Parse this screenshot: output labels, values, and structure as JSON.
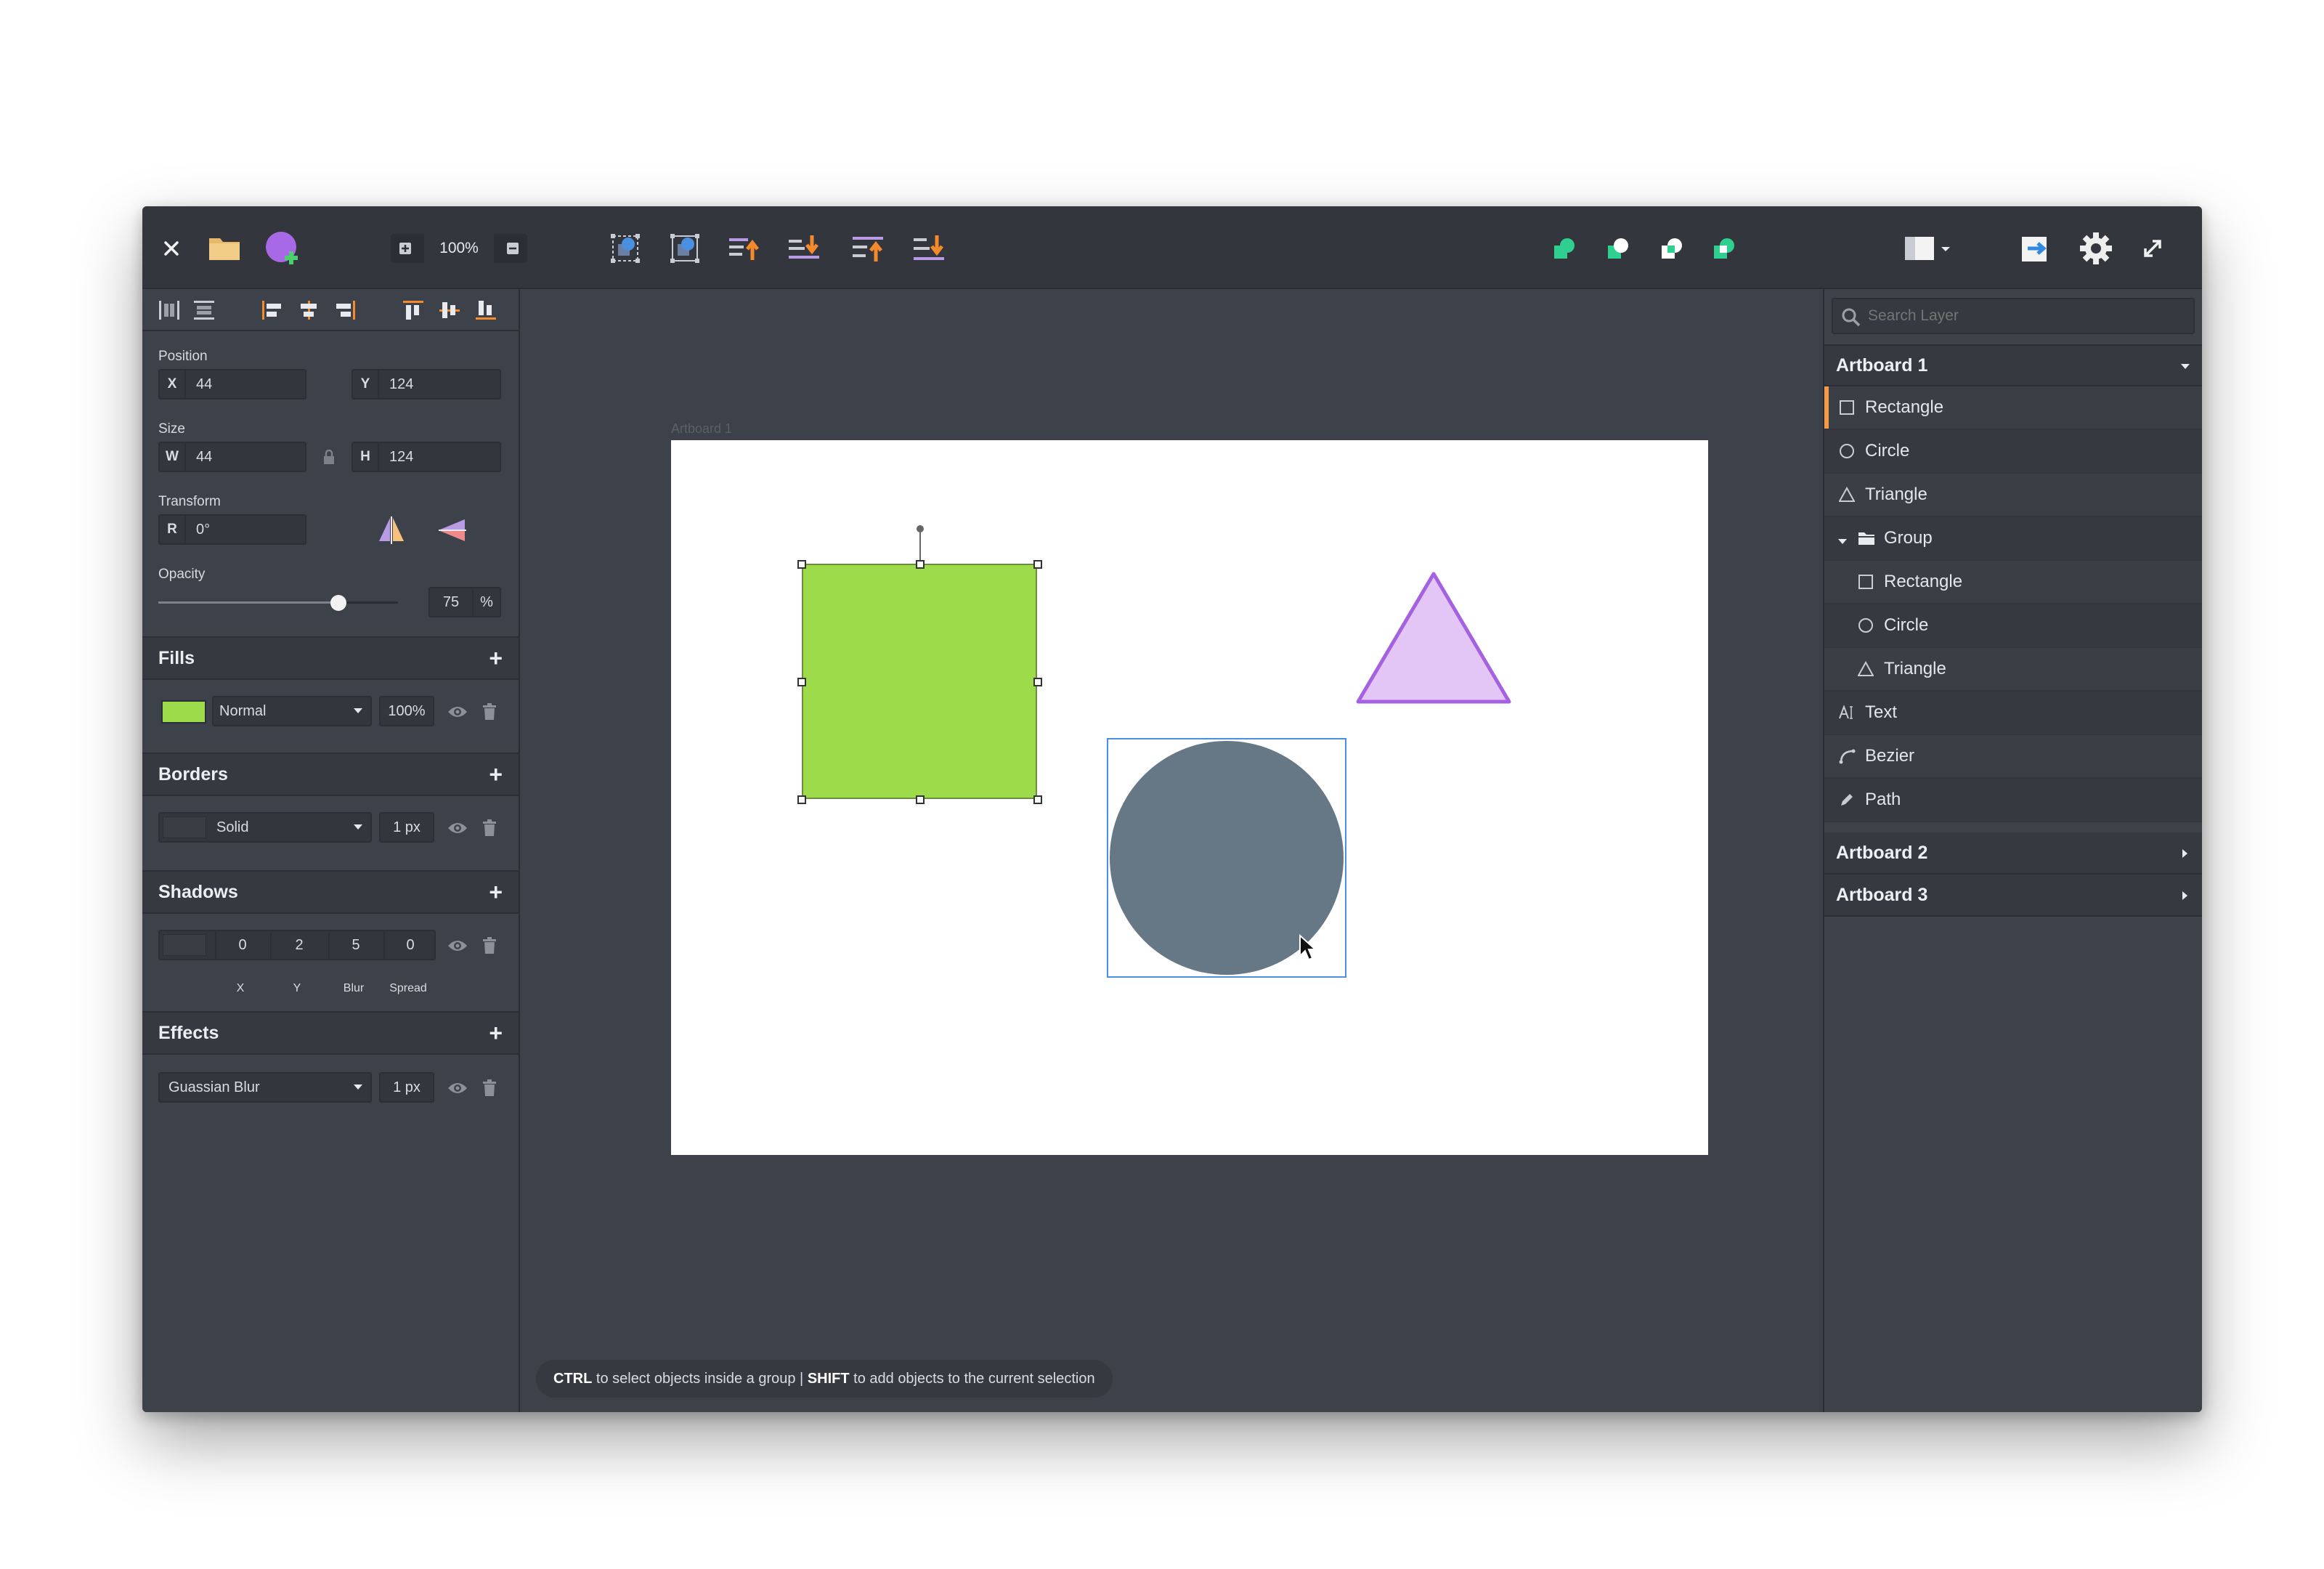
{
  "toolbar": {
    "zoom_value": "100%"
  },
  "left": {
    "position_label": "Position",
    "x_key": "X",
    "x_value": "44",
    "y_key": "Y",
    "y_value": "124",
    "size_label": "Size",
    "w_key": "W",
    "w_value": "44",
    "h_key": "H",
    "h_value": "124",
    "transform_label": "Transform",
    "r_key": "R",
    "r_value": "0°",
    "opacity_label": "Opacity",
    "opacity_value": "75",
    "opacity_fraction": 0.75,
    "opacity_unit": "%",
    "fills": {
      "title": "Fills",
      "add": "+",
      "color": "#9ddb4b",
      "blend": "Normal",
      "percent": "100%"
    },
    "borders": {
      "title": "Borders",
      "add": "+",
      "color": "#3a3d44",
      "style": "Solid",
      "width": "1 px"
    },
    "shadows": {
      "title": "Shadows",
      "add": "+",
      "color": "#3a3d44",
      "x": "0",
      "y": "2",
      "blur": "5",
      "spread": "0",
      "x_label": "X",
      "y_label": "Y",
      "blur_label": "Blur",
      "spread_label": "Spread"
    },
    "effects": {
      "title": "Effects",
      "add": "+",
      "type": "Guassian Blur",
      "value": "1 px"
    }
  },
  "canvas": {
    "artboard_label": "Artboard 1",
    "status_ctrl": "CTRL",
    "status_ctrl_text": " to select objects inside a group | ",
    "status_shift": "SHIFT",
    "status_shift_text": " to add objects to the current selection"
  },
  "layers": {
    "search_placeholder": "Search Layer",
    "artboard1": "Artboard 1",
    "items": [
      {
        "label": "Rectangle",
        "icon": "rectangle-icon"
      },
      {
        "label": "Circle",
        "icon": "circle-icon"
      },
      {
        "label": "Triangle",
        "icon": "triangle-icon"
      },
      {
        "label": "Group",
        "icon": "folder-icon"
      },
      {
        "label": "Rectangle",
        "icon": "rectangle-icon"
      },
      {
        "label": "Circle",
        "icon": "circle-icon"
      },
      {
        "label": "Triangle",
        "icon": "triangle-icon"
      },
      {
        "label": "Text",
        "icon": "text-icon"
      },
      {
        "label": "Bezier",
        "icon": "bezier-icon"
      },
      {
        "label": "Path",
        "icon": "pencil-icon"
      }
    ],
    "artboard2": "Artboard 2",
    "artboard3": "Artboard 3"
  },
  "colors": {
    "accent": "#f59a4a",
    "shape_green": "#9ddb4b",
    "shape_circle": "#667886",
    "shape_triangle_fill": "#e3c6f6",
    "shape_triangle_stroke": "#a461e0",
    "selection": "#4a90e2"
  }
}
